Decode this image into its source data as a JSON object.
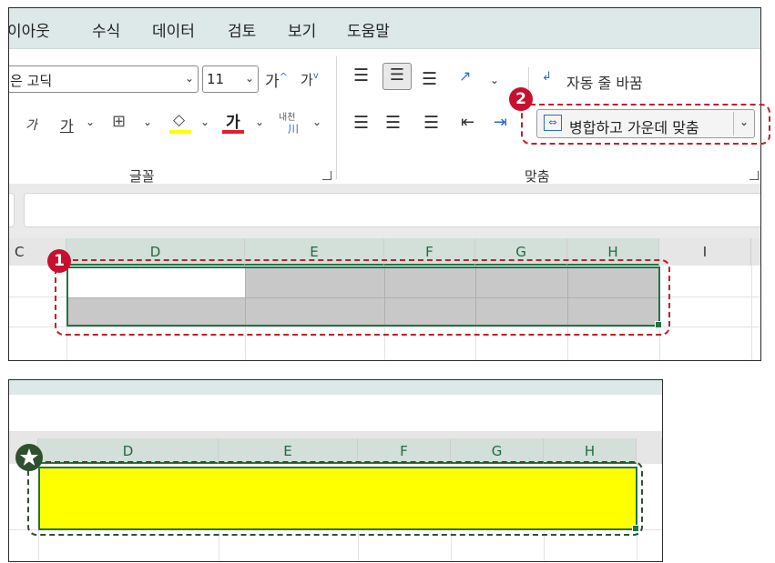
{
  "menu": [
    "이아웃",
    "수식",
    "데이터",
    "검토",
    "보기",
    "도움말"
  ],
  "font_group": {
    "font_name": "은 고딕",
    "font_size": "11",
    "grow_font": "가",
    "shrink_font": "가",
    "italic": "가",
    "underline": "가",
    "font_color": "가",
    "phonetic_top": "내천",
    "phonetic_bottom": "川",
    "label": "글꼴"
  },
  "alignment_group": {
    "wrap_text": "자동 줄 바꿈",
    "merge_center": "병합하고 가운데 맞춤",
    "label": "맞춤"
  },
  "columns_top": [
    "C",
    "D",
    "E",
    "F",
    "G",
    "H",
    "I"
  ],
  "columns_bottom": [
    "D",
    "E",
    "F",
    "G",
    "H"
  ],
  "badges": {
    "one": "1",
    "two": "2"
  },
  "colors": {
    "fill_yellow": "#FFFF00",
    "font_red": "#E0202A",
    "selection_green": "#217346",
    "annotation_red": "#C0202A",
    "annotation_green": "#2F4F2F"
  }
}
